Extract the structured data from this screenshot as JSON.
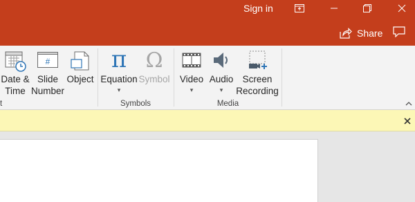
{
  "titlebar": {
    "sign_in": "Sign in",
    "window_buttons": [
      "ribbon-display-options-icon",
      "minimize-icon",
      "restore-icon",
      "close-icon"
    ],
    "share_label": "Share",
    "color": "#c43e1c"
  },
  "ribbon": {
    "text_group": {
      "date_time": {
        "line1": "Date &",
        "line2": "Time"
      },
      "slide_number": {
        "line1": "Slide",
        "line2": "Number"
      },
      "object": {
        "line1": "Object"
      },
      "group_label_fragment": "t"
    },
    "symbols_group": {
      "equation": {
        "label": "Equation",
        "dropdown": "▾"
      },
      "symbol": {
        "label": "Symbol",
        "state": "disabled"
      },
      "group_label": "Symbols"
    },
    "media_group": {
      "video": {
        "label": "Video",
        "dropdown": "▾"
      },
      "audio": {
        "label": "Audio",
        "dropdown": "▾"
      },
      "screen_recording": {
        "line1": "Screen",
        "line2": "Recording"
      },
      "group_label": "Media"
    }
  },
  "message_bar": {
    "color": "#fcf7b6"
  },
  "icons": {
    "date_time": "calendar-clock-icon",
    "slide_number": "slide-number-icon",
    "object": "object-icon",
    "equation": "pi-icon",
    "symbol": "omega-icon",
    "video": "film-icon",
    "audio": "speaker-icon",
    "screen_recording": "screen-recording-icon"
  }
}
